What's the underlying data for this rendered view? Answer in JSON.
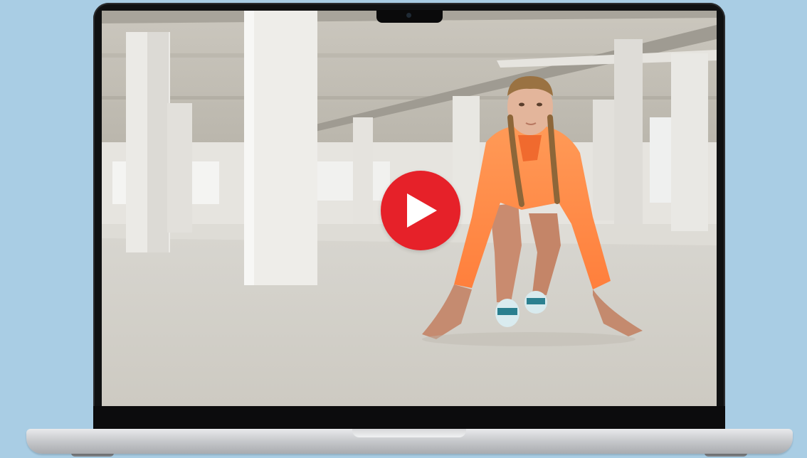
{
  "page": {
    "background_color": "#a9cde4"
  },
  "device": {
    "type": "laptop",
    "bezel_color": "#101112",
    "body_color": "#c9cbce"
  },
  "video": {
    "play_button": {
      "icon": "play-icon",
      "color": "#e62129"
    },
    "thumbnail_colors": {
      "jacket": "#ff8a45",
      "floor": "#d3d0c9",
      "ceiling": "#c9c5bc"
    }
  }
}
